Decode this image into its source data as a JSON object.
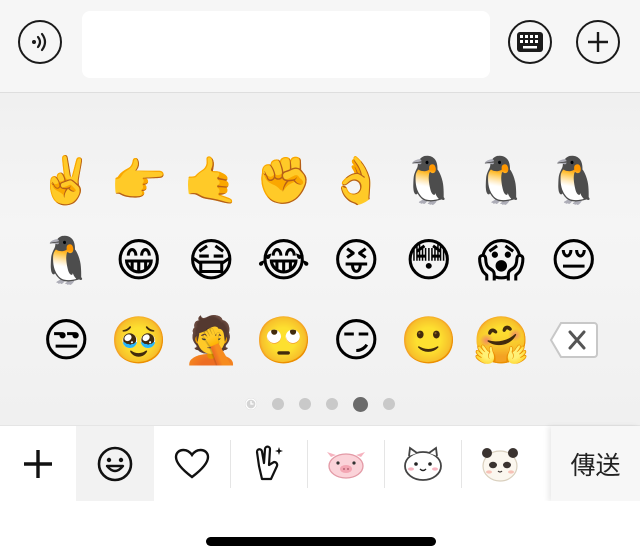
{
  "input_bar": {
    "voice_icon": "voice-icon",
    "text_value": "",
    "keyboard_icon": "keyboard-icon",
    "more_icon": "plus-icon"
  },
  "emoji_grid": {
    "rows": [
      [
        "✌️",
        "👉",
        "🤙",
        "✊",
        "👌",
        "🐧",
        "🐧",
        "🐧"
      ],
      [
        "🐧",
        "😁",
        "😷",
        "😂",
        "😝",
        "😳",
        "😱",
        "😔"
      ],
      [
        "😒",
        "🥹",
        "🤦",
        "🙄",
        "😏",
        "🙂",
        "🤗",
        "⌫"
      ]
    ]
  },
  "pager": {
    "page_count": 6,
    "current_page": 5
  },
  "tabs": [
    {
      "name": "add",
      "icon": "plus-icon"
    },
    {
      "name": "emoji",
      "icon": "smile-icon"
    },
    {
      "name": "favorites",
      "icon": "heart-icon"
    },
    {
      "name": "gesture",
      "icon": "hand-sparkle-icon"
    },
    {
      "name": "pig-sticker",
      "icon": "pig-icon"
    },
    {
      "name": "cat-sticker",
      "icon": "cat-icon"
    },
    {
      "name": "panda-sticker",
      "icon": "panda-icon"
    }
  ],
  "send_label": "傳送"
}
